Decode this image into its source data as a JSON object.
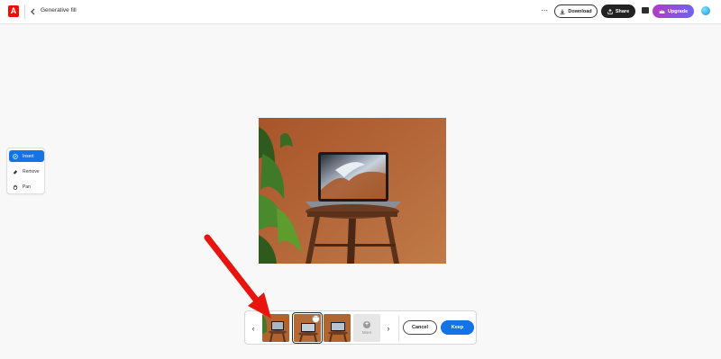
{
  "header": {
    "title": "Generative fill",
    "download_label": "Download",
    "share_label": "Share",
    "upgrade_label": "Upgrade",
    "icons": [
      "adobe-logo-icon",
      "back-chevron-icon",
      "more-icon",
      "download-icon",
      "share-icon",
      "comment-icon",
      "crown-icon",
      "avatar"
    ]
  },
  "tools": {
    "items": [
      {
        "label": "Insert",
        "icon": "insert-icon",
        "active": true
      },
      {
        "label": "Remove",
        "icon": "eraser-icon",
        "active": false
      },
      {
        "label": "Pan",
        "icon": "hand-icon",
        "active": false
      }
    ]
  },
  "canvas": {
    "description_icon": "image"
  },
  "variations": {
    "thumb_count": 3,
    "selected_index": 1,
    "new_label": "More",
    "cancel_label": "Cancel",
    "keep_label": "Keep"
  },
  "colors": {
    "accent_blue": "#1473e6",
    "adobe_red": "#eb1000",
    "upgrade_purple": "#8a4fe0",
    "arrow_red": "#e8150f"
  }
}
